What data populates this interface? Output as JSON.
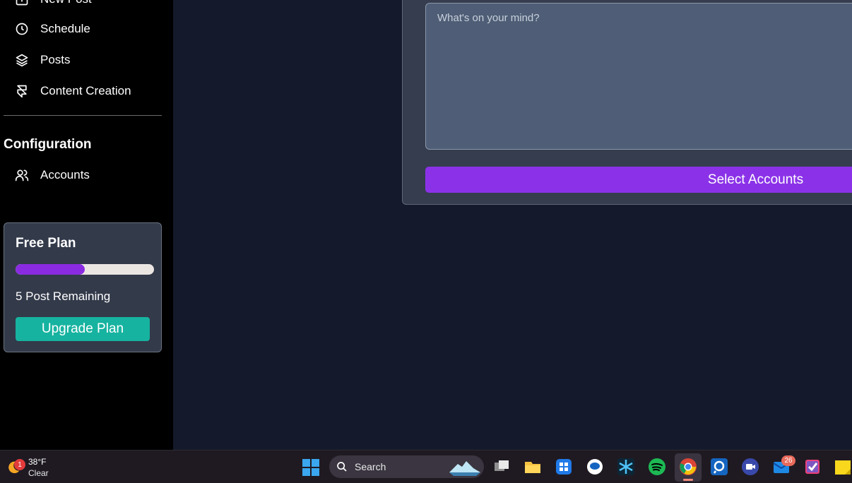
{
  "sidebar": {
    "nav_items": [
      {
        "label": "New Post",
        "icon": "plus-square-icon"
      },
      {
        "label": "Schedule",
        "icon": "clock-icon"
      },
      {
        "label": "Posts",
        "icon": "layers-icon"
      },
      {
        "label": "Content Creation",
        "icon": "framer-icon"
      }
    ],
    "config_title": "Configuration",
    "config_items": [
      {
        "label": "Accounts",
        "icon": "users-icon"
      }
    ],
    "plan": {
      "title": "Free Plan",
      "progress_fraction": 0.5,
      "remaining": "5 Post Remaining",
      "upgrade_label": "Upgrade Plan"
    }
  },
  "composer": {
    "placeholder": "What's on your mind?",
    "select_label": "Select Accounts"
  },
  "taskbar": {
    "weather": {
      "temp": "38°F",
      "condition": "Clear",
      "badge": "1"
    },
    "search_label": "Search",
    "mail_badge": "26",
    "apps": [
      "task-view-icon",
      "file-explorer-icon",
      "app-grid-icon",
      "chat-bubble-icon",
      "star-app-icon",
      "spotify-icon",
      "chrome-icon",
      "screen-search-icon",
      "video-call-icon",
      "mail-icon",
      "checklist-icon",
      "sticky-notes-icon"
    ]
  },
  "colors": {
    "accent_purple": "#8b32e8",
    "teal": "#16b3a0",
    "background": "#141a2b"
  }
}
